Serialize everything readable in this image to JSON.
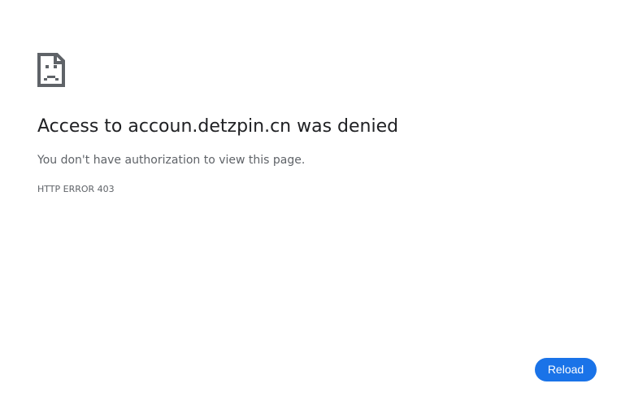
{
  "icon": {
    "name": "sad-document-icon"
  },
  "error": {
    "title": "Access to accoun.detzpin.cn was denied",
    "summary": "You don't have authorization to view this page.",
    "code": "HTTP ERROR 403"
  },
  "actions": {
    "reload_label": "Reload"
  },
  "colors": {
    "accent": "#1a73e8",
    "text_primary": "#202124",
    "text_secondary": "#5f6368",
    "icon": "#5f6368"
  }
}
